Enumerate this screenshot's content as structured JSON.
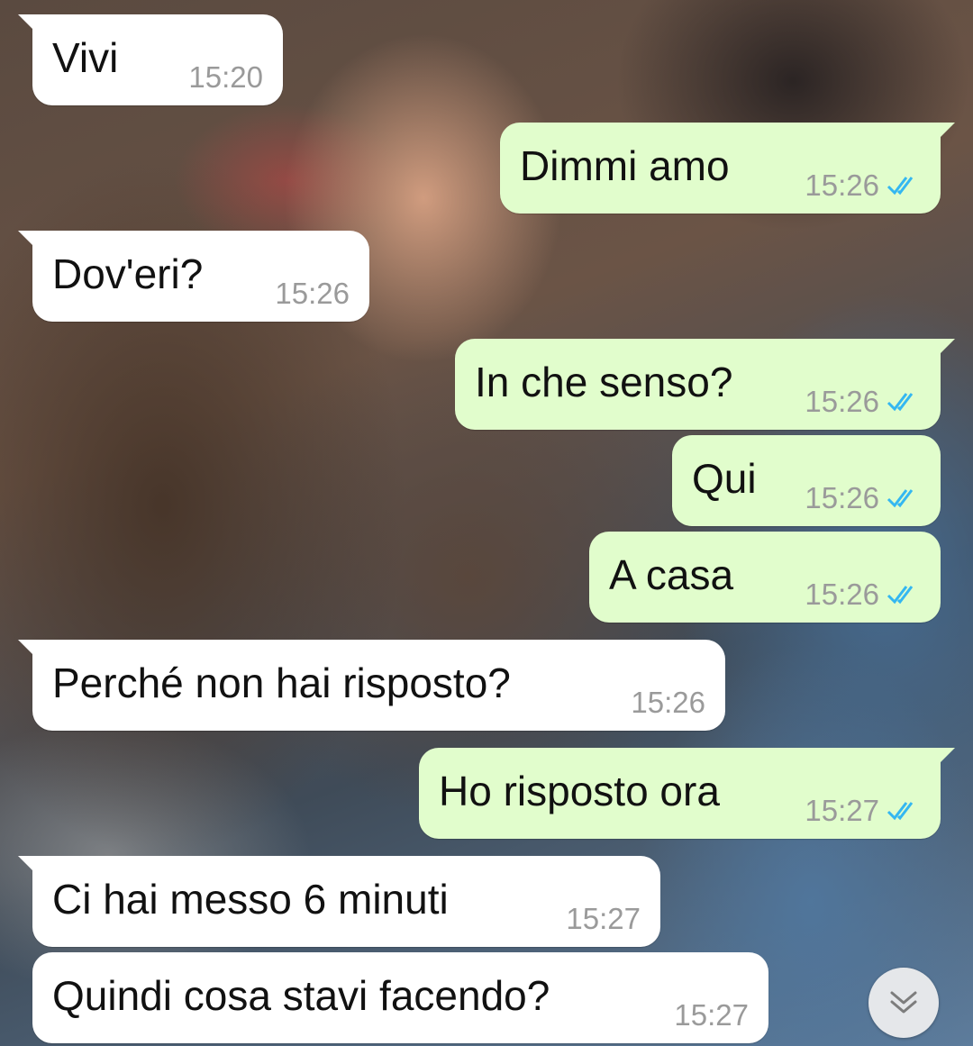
{
  "chat": {
    "messages": [
      {
        "direction": "in",
        "text": "Vivi",
        "time": "15:20"
      },
      {
        "direction": "out",
        "text": "Dimmi amo",
        "time": "15:26",
        "status": "read"
      },
      {
        "direction": "in",
        "text": "Dov'eri?",
        "time": "15:26"
      },
      {
        "direction": "out",
        "text": "In che senso?",
        "time": "15:26",
        "status": "read"
      },
      {
        "direction": "out",
        "text": "Qui",
        "time": "15:26",
        "status": "read"
      },
      {
        "direction": "out",
        "text": "A casa",
        "time": "15:26",
        "status": "read"
      },
      {
        "direction": "in",
        "text": "Perché non hai risposto?",
        "time": "15:26"
      },
      {
        "direction": "out",
        "text": "Ho risposto ora",
        "time": "15:27",
        "status": "read"
      },
      {
        "direction": "in",
        "text": "Ci hai messo 6 minuti",
        "time": "15:27"
      },
      {
        "direction": "in",
        "text": "Quindi cosa stavi facendo?",
        "time": "15:27"
      }
    ]
  },
  "scroll_button": {
    "icon": "double-chevron-down-icon"
  },
  "colors": {
    "incoming_bubble": "#ffffff",
    "outgoing_bubble": "#e1fdcc",
    "timestamp": "#9a9a9a",
    "read_ticks": "#34b7f1"
  }
}
